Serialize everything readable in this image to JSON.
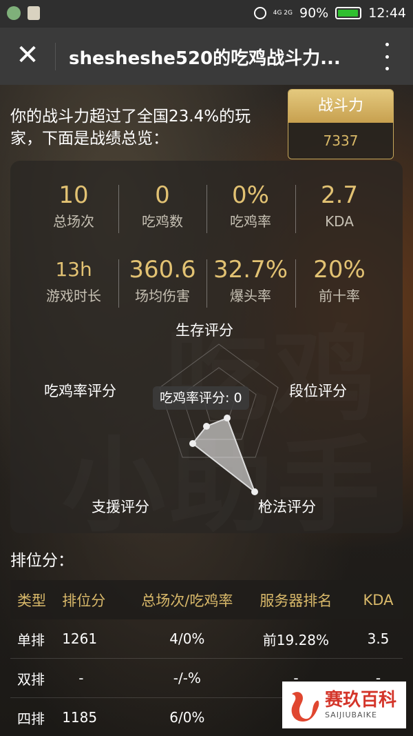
{
  "status_bar": {
    "network": "4G 2G",
    "battery_percent": "90%",
    "time": "12:44"
  },
  "title_bar": {
    "title": "shesheshe520的吃鸡战斗力..."
  },
  "summary": {
    "text": "你的战斗力超过了全国23.4%的玩家，下面是战绩总览："
  },
  "power": {
    "label": "战斗力",
    "value": "7337"
  },
  "stats": [
    {
      "value": "10",
      "label": "总场次"
    },
    {
      "value": "0",
      "label": "吃鸡数"
    },
    {
      "value": "0%",
      "label": "吃鸡率"
    },
    {
      "value": "2.7",
      "label": "KDA"
    },
    {
      "value": "13h",
      "label": "游戏时长"
    },
    {
      "value": "360.6",
      "label": "场均伤害"
    },
    {
      "value": "32.7%",
      "label": "爆头率"
    },
    {
      "value": "20%",
      "label": "前十率"
    }
  ],
  "radar": {
    "axes": [
      "生存评分",
      "段位评分",
      "枪法评分",
      "支援评分",
      "吃鸡率评分"
    ],
    "tooltip": "吃鸡率评分: 0"
  },
  "background_art": {
    "text": "吃鸡小助手"
  },
  "ranking": {
    "title": "排位分：",
    "headers": [
      "类型",
      "排位分",
      "总场次/吃鸡率",
      "服务器排名",
      "KDA"
    ],
    "rows": [
      [
        "单排",
        "1261",
        "4/0%",
        "前19.28%",
        "3.5"
      ],
      [
        "双排",
        "-",
        "-/-%",
        "-",
        "-"
      ],
      [
        "四排",
        "1185",
        "6/0%",
        "前",
        ""
      ]
    ]
  },
  "watermark": {
    "name": "赛玖百科",
    "sub": "SAIJIUBAIKE"
  }
}
